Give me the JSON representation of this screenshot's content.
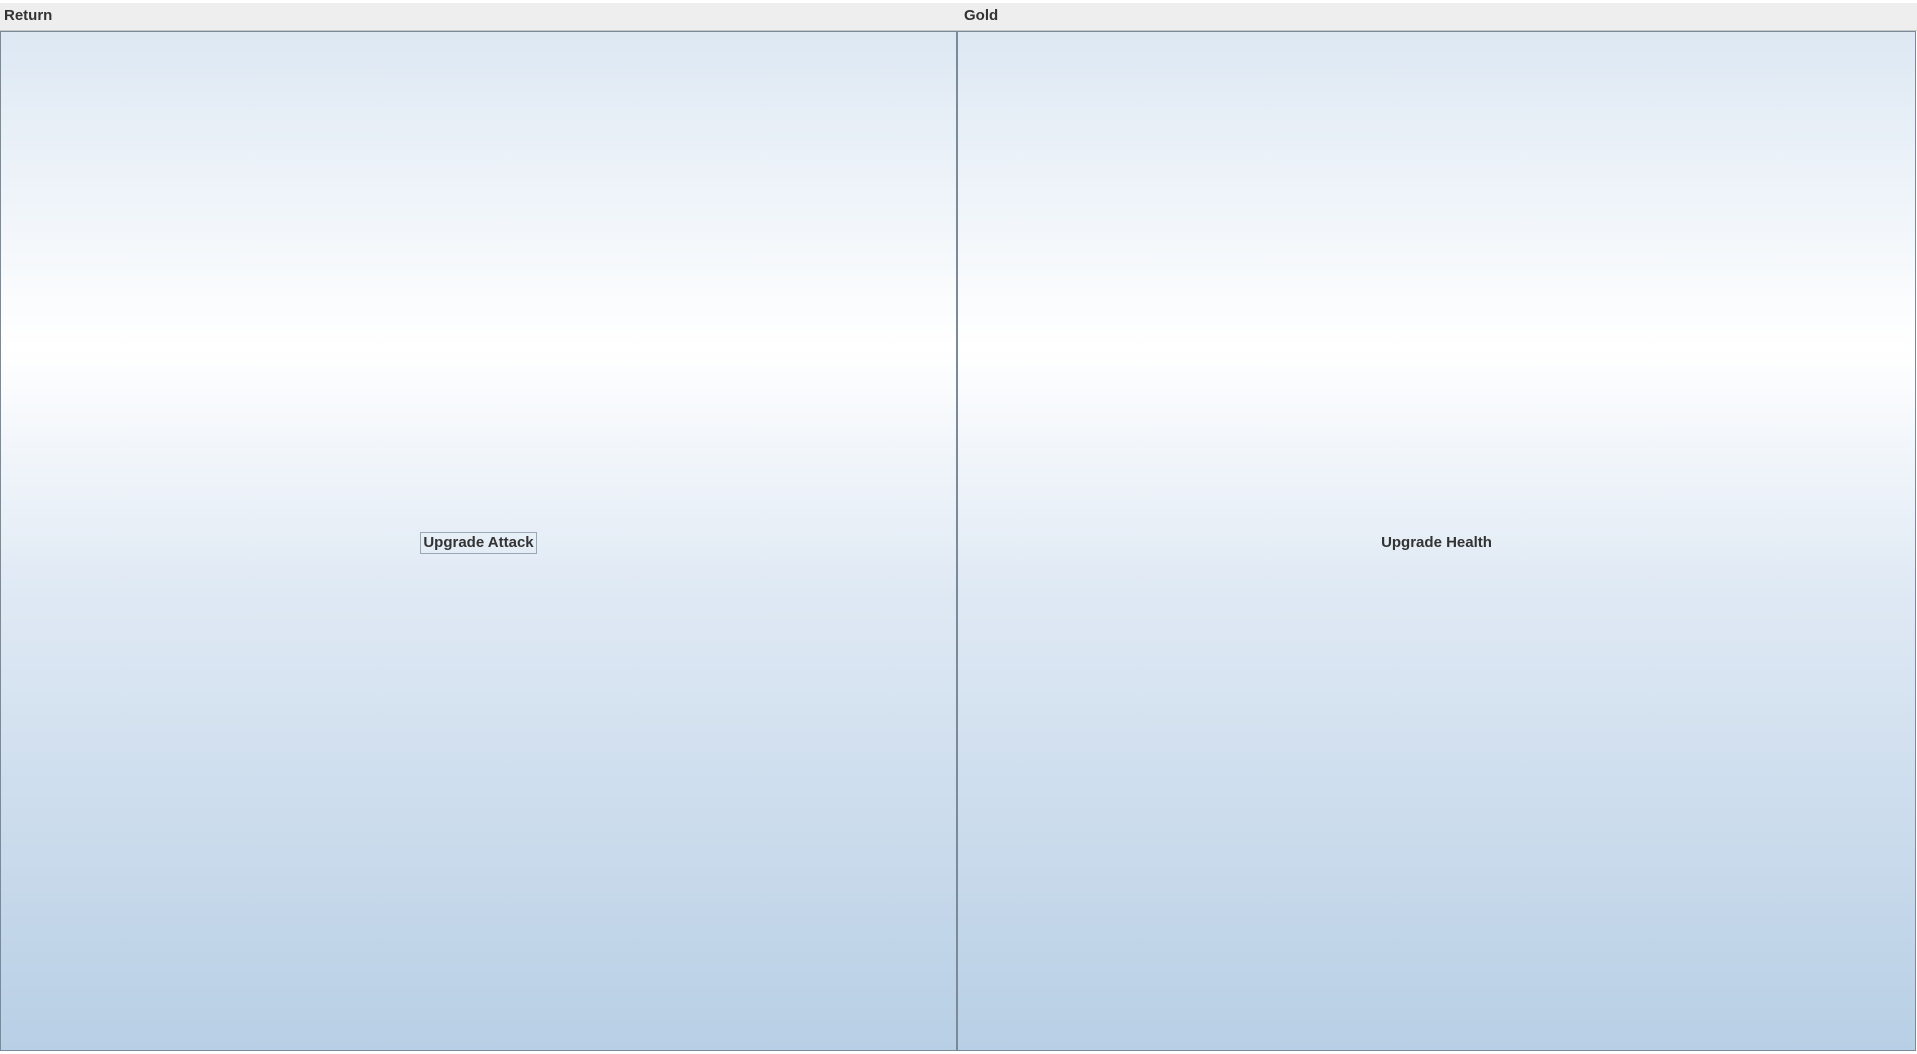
{
  "topbar": {
    "return_label": "Return",
    "gold_label": "Gold"
  },
  "buttons": {
    "upgrade_attack": "Upgrade Attack",
    "upgrade_health": "Upgrade Health"
  },
  "colors": {
    "topbar_bg": "#eeeeee",
    "gradient_top": "#dde8f3",
    "gradient_highlight": "#ffffff",
    "gradient_bottom": "#b8cfe5",
    "text": "#333333"
  }
}
